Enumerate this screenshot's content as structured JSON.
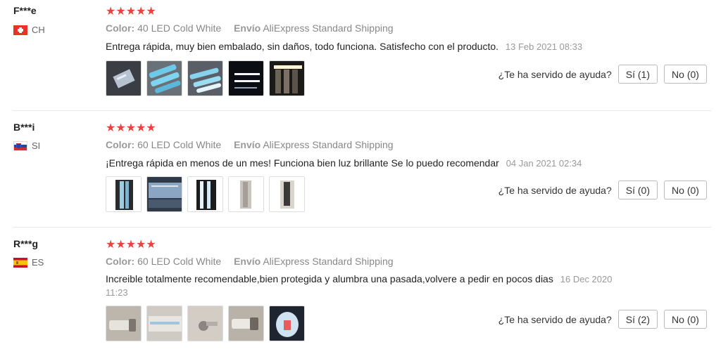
{
  "reviews": [
    {
      "user": "F***e",
      "country_code": "CH",
      "stars": "★★★★★",
      "color_label": "Color:",
      "color_value": "40 LED Cold White",
      "shipping_label": "Envío",
      "shipping_value": "AliExpress Standard Shipping",
      "text": "Entrega rápida, muy bien embalado, sin daños, todo funciona. Satisfecho con el producto.",
      "date": "13 Feb 2021 08:33",
      "helpful_question": "¿Te ha servido de ayuda?",
      "yes_label": "Sí (1)",
      "no_label": "No (0)"
    },
    {
      "user": "B***i",
      "country_code": "SI",
      "stars": "★★★★★",
      "color_label": "Color:",
      "color_value": "60 LED Cold White",
      "shipping_label": "Envío",
      "shipping_value": "AliExpress Standard Shipping",
      "text": "¡Entrega rápida en menos de un mes! Funciona bien luz brillante Se lo puedo recomendar",
      "date": "04 Jan 2021 02:34",
      "helpful_question": "¿Te ha servido de ayuda?",
      "yes_label": "Sí (0)",
      "no_label": "No (0)"
    },
    {
      "user": "R***g",
      "country_code": "ES",
      "stars": "★★★★★",
      "color_label": "Color:",
      "color_value": "60 LED Cold White",
      "shipping_label": "Envío",
      "shipping_value": "AliExpress Standard Shipping",
      "text": "Increible totalmente recomendable,bien protegida y alumbra una pasada,volvere a pedir en pocos dias",
      "date": "16 Dec 2020 11:23",
      "helpful_question": "¿Te ha servido de ayuda?",
      "yes_label": "Sí (2)",
      "no_label": "No (0)"
    }
  ]
}
